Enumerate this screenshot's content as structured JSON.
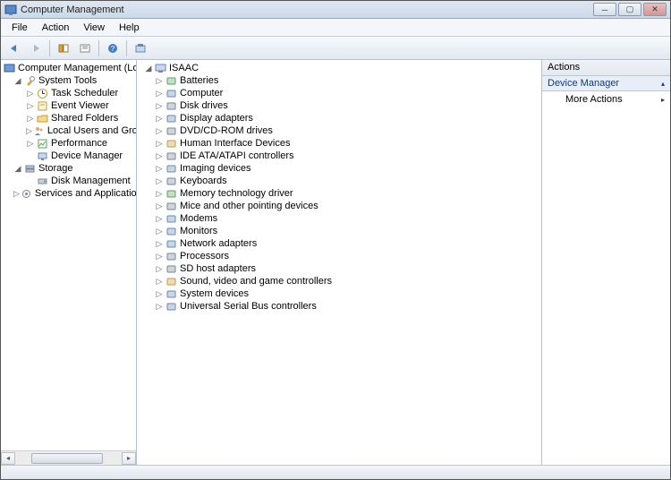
{
  "window": {
    "title": "Computer Management"
  },
  "menu": {
    "file": "File",
    "action": "Action",
    "view": "View",
    "help": "Help"
  },
  "left_tree": {
    "root": "Computer Management (Local)",
    "system_tools": {
      "label": "System Tools",
      "children": {
        "task_scheduler": "Task Scheduler",
        "event_viewer": "Event Viewer",
        "shared_folders": "Shared Folders",
        "local_users": "Local Users and Groups",
        "performance": "Performance",
        "device_manager": "Device Manager"
      }
    },
    "storage": {
      "label": "Storage",
      "children": {
        "disk_management": "Disk Management"
      }
    },
    "services": "Services and Applications"
  },
  "center_tree": {
    "root": "ISAAC",
    "items": [
      "Batteries",
      "Computer",
      "Disk drives",
      "Display adapters",
      "DVD/CD-ROM drives",
      "Human Interface Devices",
      "IDE ATA/ATAPI controllers",
      "Imaging devices",
      "Keyboards",
      "Memory technology driver",
      "Mice and other pointing devices",
      "Modems",
      "Monitors",
      "Network adapters",
      "Processors",
      "SD host adapters",
      "Sound, video and game controllers",
      "System devices",
      "Universal Serial Bus controllers"
    ]
  },
  "actions": {
    "header": "Actions",
    "section": "Device Manager",
    "more": "More Actions"
  }
}
